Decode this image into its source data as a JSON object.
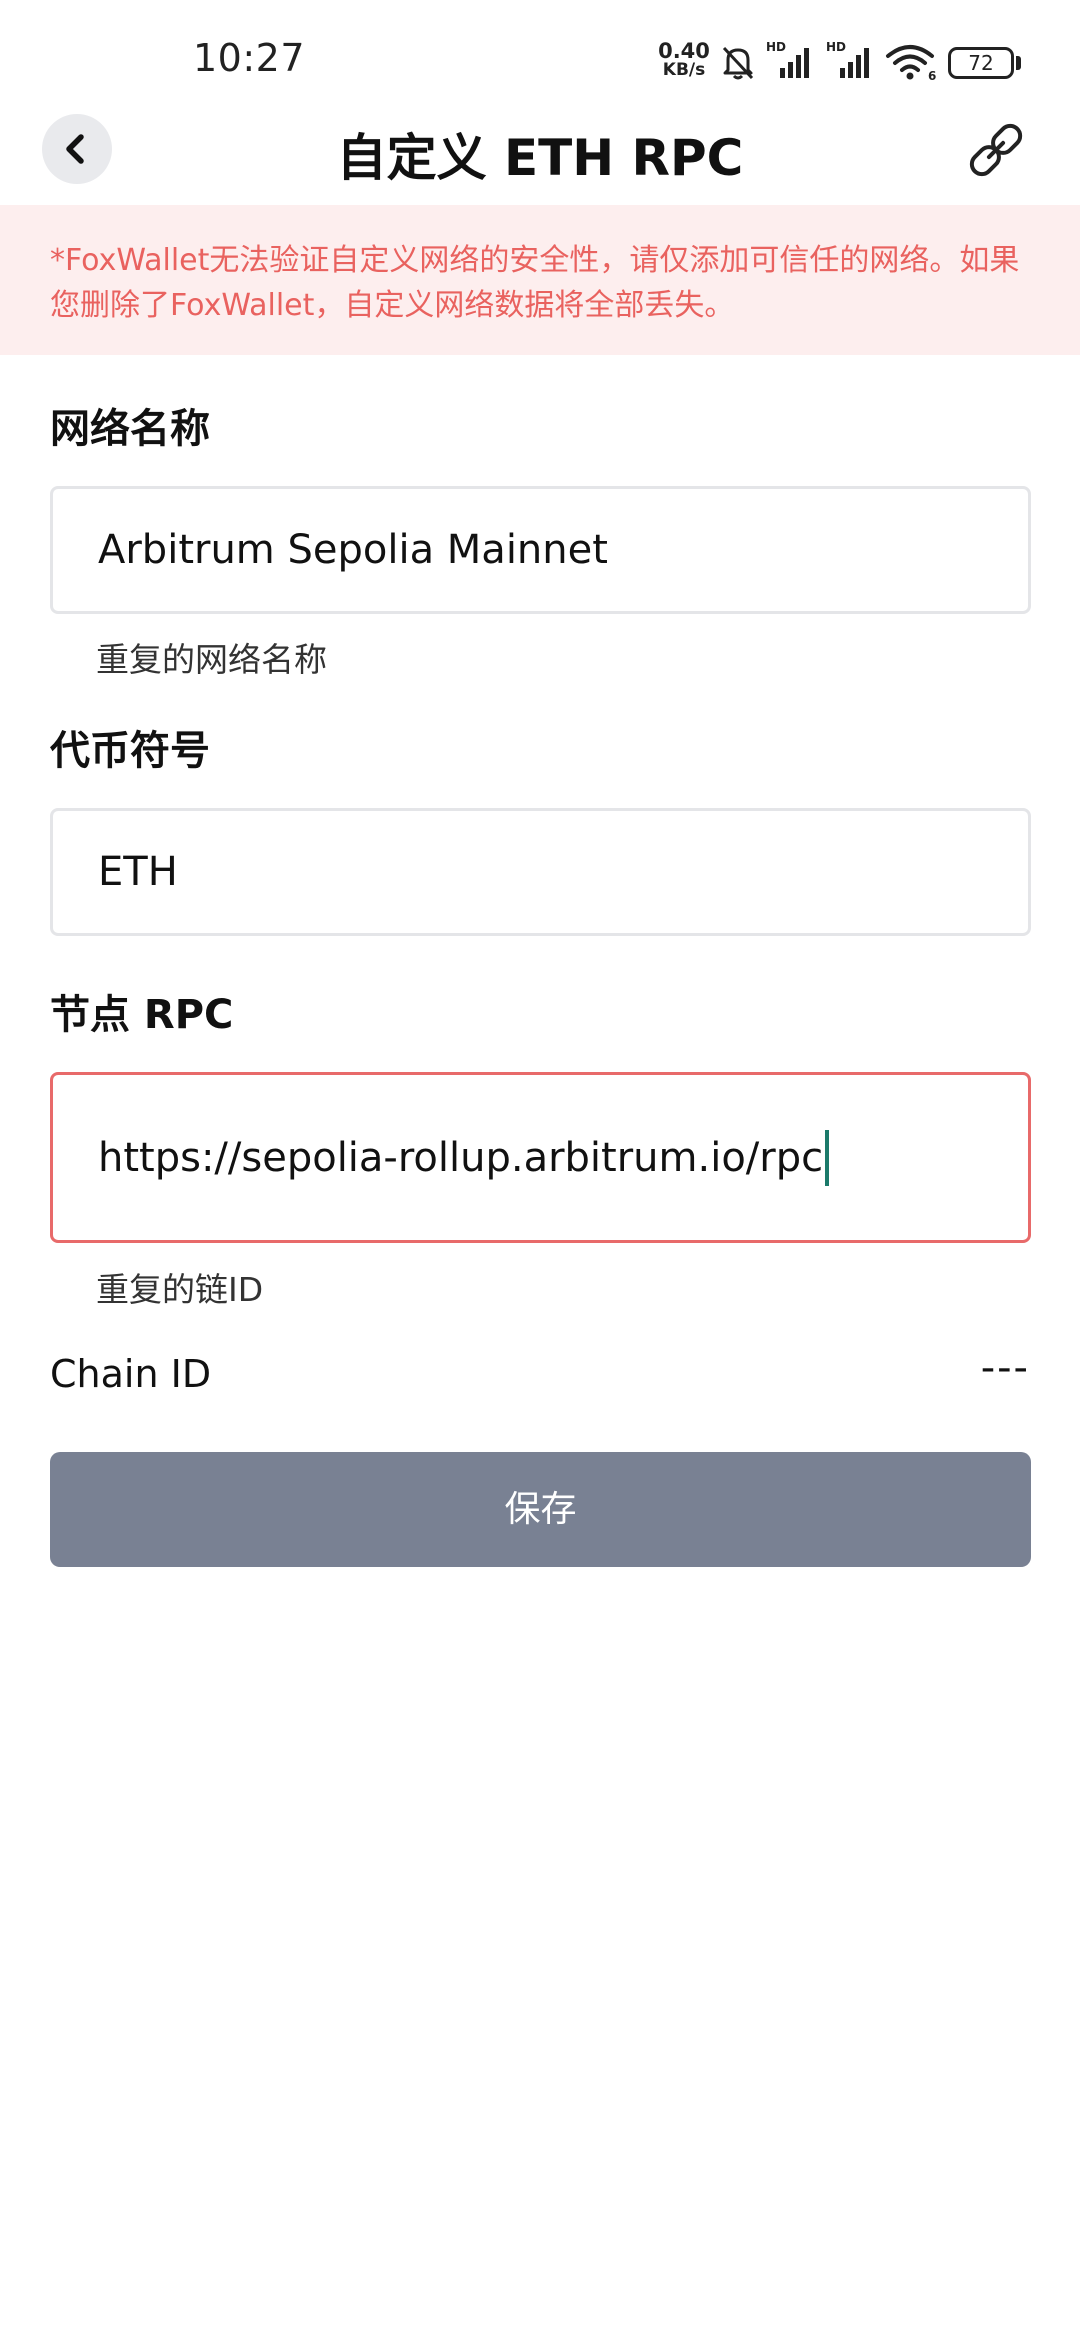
{
  "status_bar": {
    "time": "10:27",
    "net_speed_value": "0.40",
    "net_speed_unit": "KB/s",
    "battery_level": "72",
    "battery_fraction": 0.72,
    "icons": [
      "bell-muted-icon",
      "signal-hd-icon",
      "signal-hd-icon",
      "wifi-6-icon",
      "battery-icon"
    ]
  },
  "header": {
    "title": "自定义 ETH RPC",
    "back_icon": "chevron-left-icon",
    "link_icon": "link-icon"
  },
  "warning": {
    "text": "*FoxWallet无法验证自定义网络的安全性，请仅添加可信任的网络。如果您删除了FoxWallet，自定义网络数据将全部丢失。"
  },
  "form": {
    "network_name": {
      "label": "网络名称",
      "value": "Arbitrum Sepolia Mainnet",
      "hint": "重复的网络名称"
    },
    "symbol": {
      "label": "代币符号",
      "value": "ETH"
    },
    "rpc": {
      "label": "节点 RPC",
      "value": "https://sepolia-rollup.arbitrum.io/rpc",
      "hint": "重复的链ID"
    },
    "chain_id": {
      "label": "Chain ID",
      "value": "---"
    }
  },
  "save_label": "保存",
  "colors": {
    "warning_text": "#e9625f",
    "warning_bg": "#fdeeee",
    "error_border": "#e86a6a",
    "save_button": "#798193",
    "caret": "#1b7a6a"
  }
}
